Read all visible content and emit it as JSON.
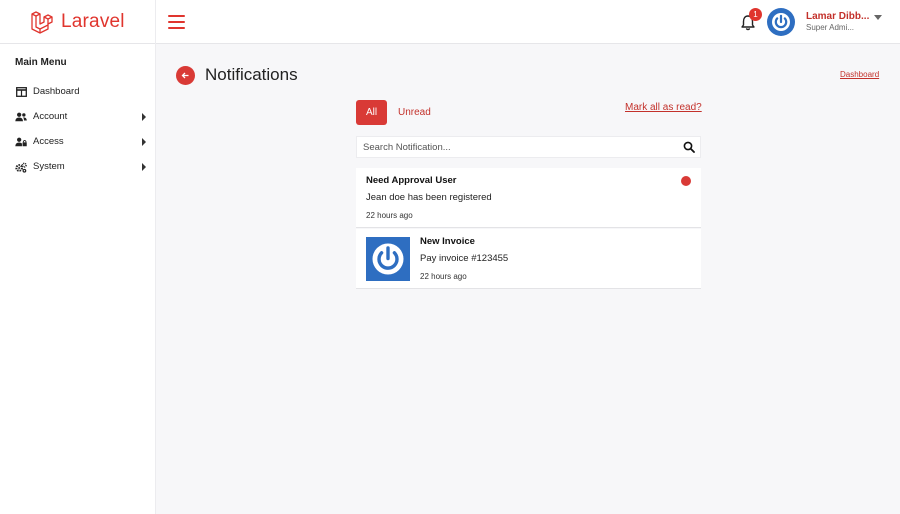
{
  "brand": {
    "name": "Laravel"
  },
  "header": {
    "notification_count": "1",
    "user_name": "Lamar Dibb...",
    "user_role": "Super Admi..."
  },
  "sidebar": {
    "title": "Main Menu",
    "items": [
      {
        "label": "Dashboard",
        "icon": "columns-icon",
        "has_submenu": false
      },
      {
        "label": "Account",
        "icon": "users-icon",
        "has_submenu": true
      },
      {
        "label": "Access",
        "icon": "user-lock-icon",
        "has_submenu": true
      },
      {
        "label": "System",
        "icon": "cogs-icon",
        "has_submenu": true
      }
    ]
  },
  "page": {
    "title": "Notifications",
    "breadcrumb_link": "Dashboard"
  },
  "tabs": {
    "all": "All",
    "unread": "Unread",
    "mark_all": "Mark all as read?"
  },
  "search": {
    "placeholder": "Search Notification...",
    "value": ""
  },
  "notifications": [
    {
      "title": "Need Approval User",
      "body": "Jean doe has been registered",
      "time": "22 hours ago",
      "unread": true
    },
    {
      "title": "New Invoice",
      "body": "Pay invoice #123455",
      "time": "22 hours ago",
      "unread": false
    }
  ],
  "colors": {
    "accent": "#d93a36",
    "brand": "#e0352e",
    "avatar_bg": "#2e6ec1"
  }
}
